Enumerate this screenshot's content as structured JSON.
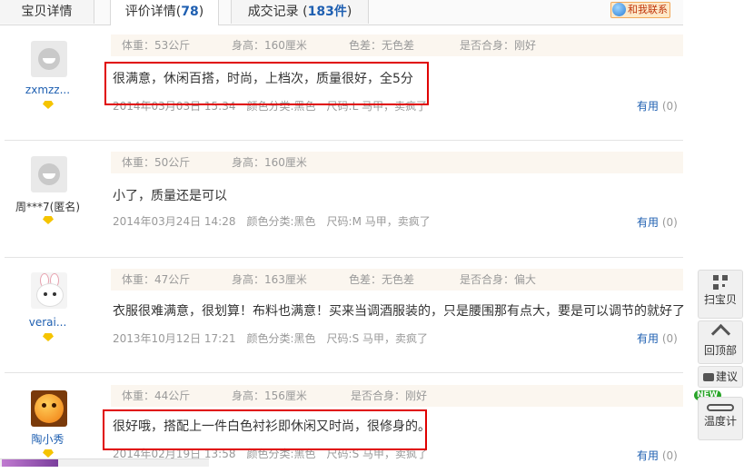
{
  "tabs": [
    {
      "label": "宝贝详情",
      "count": ""
    },
    {
      "label": "评价详情(",
      "count": "78",
      "suffix": ")"
    },
    {
      "label": "成交记录 (",
      "count": "183件",
      "suffix": ")"
    }
  ],
  "contact_label": "和我联系",
  "reviews": [
    {
      "user": "zxmzz...",
      "meta": {
        "weight": "体重：53公斤",
        "height": "身高：160厘米",
        "color_diff": "色差：无色差",
        "fit": "是否合身：刚好"
      },
      "comment": "很满意，休闲百搭，时尚，上档次，质量很好，全5分",
      "time": "2014年03月03日 15:34",
      "color": "颜色分类:黑色",
      "size": "尺码:L 马甲，卖疯了",
      "useful": "有用",
      "useful_count": "(0)"
    },
    {
      "user": "周***7(匿名)",
      "meta": {
        "weight": "体重：50公斤",
        "height": "身高：160厘米"
      },
      "comment": "小了，质量还是可以",
      "time": "2014年03月24日 14:28",
      "color": "颜色分类:黑色",
      "size": "尺码:M 马甲，卖疯了",
      "useful": "有用",
      "useful_count": "(0)"
    },
    {
      "user": "verai...",
      "meta": {
        "weight": "体重：47公斤",
        "height": "身高：163厘米",
        "color_diff": "色差：无色差",
        "fit": "是否合身：偏大"
      },
      "comment": "衣服很难满意，很划算！布料也满意！买来当调酒服装的，只是腰围那有点大，要是可以调节的就好了",
      "time": "2013年10月12日 17:21",
      "color": "颜色分类:黑色",
      "size": "尺码:S 马甲，卖疯了",
      "useful": "有用",
      "useful_count": "(0)"
    },
    {
      "user": "陶小秀",
      "meta": {
        "weight": "体重：44公斤",
        "height": "身高：156厘米",
        "fit": "是否合身：刚好"
      },
      "comment": "很好哦，搭配上一件白色衬衫即休闲又时尚，很修身的。",
      "time": "2014年02月19日 13:58",
      "color": "颜色分类:黑色",
      "size": "尺码:S 马甲，卖疯了",
      "useful": "有用",
      "useful_count": "(0)"
    }
  ],
  "toolbar": {
    "scan": "扫宝贝",
    "top": "回顶部",
    "suggest": "建议",
    "new_badge": "NEW",
    "thermo": "温度计"
  }
}
